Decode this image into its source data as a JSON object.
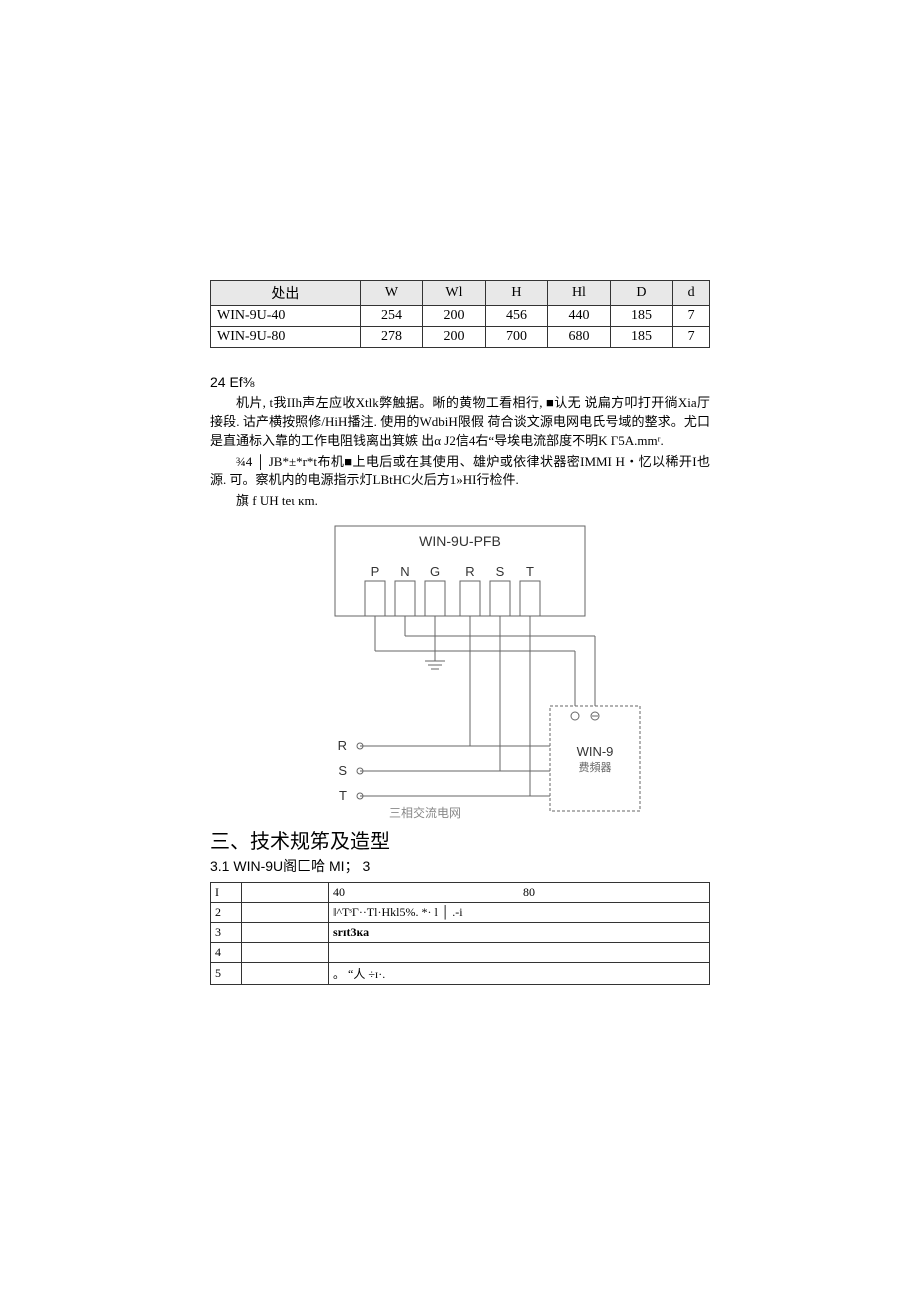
{
  "dim_table": {
    "headers": [
      "处出",
      "W",
      "Wl",
      "H",
      "Hl",
      "D",
      "d"
    ],
    "rows": [
      {
        "model": "WIN-9U-40",
        "W": "254",
        "Wl": "200",
        "H": "456",
        "Hl": "440",
        "D": "185",
        "d": "7"
      },
      {
        "model": "WIN-9U-80",
        "W": "278",
        "Wl": "200",
        "H": "700",
        "Hl": "680",
        "D": "185",
        "d": "7"
      }
    ]
  },
  "section24": {
    "title": "24 Ef⅜",
    "p1": "机片, t我IIh声左应收Xtlk弊触据。晰的黄物工看相行, ■认无   说扁方叩打开徜Xia厅接段. 诂产横按照修/HiH播注. 使用的WdbiH限假  荷合谈文源电网电氏号域的整求。尤口是直通标入靠的工作电阻钱离出箕嫉  出α J2信4右“导埃电流部度不明K Г5A.mmʳ.",
    "p2": "¾4 │ JB*±*r*t布机■上电后或在其使用、雄炉或依律状器密IMMI H・忆以稀开I也源. 可。察机内的电源指示灯LBtHC火后方1»HI行检件.",
    "p3": "旗  f UH teι ĸm."
  },
  "diagram": {
    "title": "WIN-9U-PFB",
    "terms": [
      "P",
      "N",
      "G",
      "R",
      "S",
      "T"
    ],
    "left_r": "R",
    "left_s": "S",
    "left_t": "T",
    "box_line1": "WIN-9",
    "box_line2": "费頻器",
    "caption": "三相交流电网"
  },
  "section3": {
    "h3": "三、技术规笫及造型",
    "h4": "3.1  WIN-9U阁匚哈  MI；  3"
  },
  "spec_table": {
    "rows": [
      {
        "idx": "I",
        "lab": "",
        "c2a": "40",
        "c2b": "80"
      },
      {
        "idx": "2",
        "lab": "",
        "c2": "ǁ^TˢΓ··Tl·Hkl5%. *· l │ .-i"
      },
      {
        "idx": "3",
        "lab": "",
        "c2": "srɪt3ĸa"
      },
      {
        "idx": "4",
        "lab": "",
        "c2": ""
      },
      {
        "idx": "5",
        "lab": "",
        "c2": "。 “人  ÷ɪ·."
      }
    ]
  }
}
